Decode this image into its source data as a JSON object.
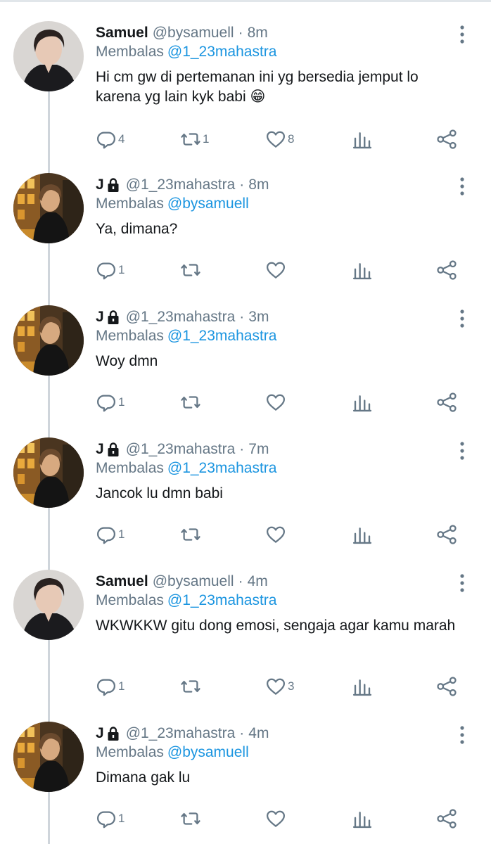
{
  "colors": {
    "text": "#14171a",
    "muted": "#657786",
    "link": "#1b95e0",
    "thread_line": "#cfd5db"
  },
  "icons": {
    "reply": "speech-bubble-icon",
    "retweet": "retweet-arrows-icon",
    "like": "heart-icon",
    "stats": "bar-chart-icon",
    "share": "share-nodes-icon",
    "more": "vertical-dots-icon",
    "locked": "lock-icon"
  },
  "tweets": [
    {
      "name": "Samuel",
      "handle": "@bysamuell",
      "separator": "·",
      "time": "8m",
      "reply_label": "Membalas",
      "reply_to": "@1_23mahastra",
      "text": "Hi cm gw di pertemanan ini yg bersedia jemput lo karena yg lain kyk babi 😁",
      "replies": "4",
      "retweets": "1",
      "likes": "8"
    },
    {
      "name": "J",
      "handle": "@1_23mahastra",
      "separator": "·",
      "time": "8m",
      "reply_label": "Membalas",
      "reply_to": "@bysamuell",
      "text": "Ya, dimana?",
      "replies": "1",
      "retweets": "",
      "likes": ""
    },
    {
      "name": "J",
      "handle": "@1_23mahastra",
      "separator": "·",
      "time": "3m",
      "reply_label": "Membalas",
      "reply_to": "@1_23mahastra",
      "text": "Woy dmn",
      "replies": "1",
      "retweets": "",
      "likes": ""
    },
    {
      "name": "J",
      "handle": "@1_23mahastra",
      "separator": "·",
      "time": "7m",
      "reply_label": "Membalas",
      "reply_to": "@1_23mahastra",
      "text": "Jancok lu dmn babi",
      "replies": "1",
      "retweets": "",
      "likes": ""
    },
    {
      "name": "Samuel",
      "handle": "@bysamuell",
      "separator": "·",
      "time": "4m",
      "reply_label": "Membalas",
      "reply_to": "@1_23mahastra",
      "text": "WKWKKW gitu dong emosi, sengaja agar kamu marah",
      "replies": "1",
      "retweets": "",
      "likes": "3"
    },
    {
      "name": "J",
      "handle": "@1_23mahastra",
      "separator": "·",
      "time": "4m",
      "reply_label": "Membalas",
      "reply_to": "@bysamuell",
      "text": "Dimana gak lu",
      "replies": "1",
      "retweets": "",
      "likes": ""
    }
  ]
}
